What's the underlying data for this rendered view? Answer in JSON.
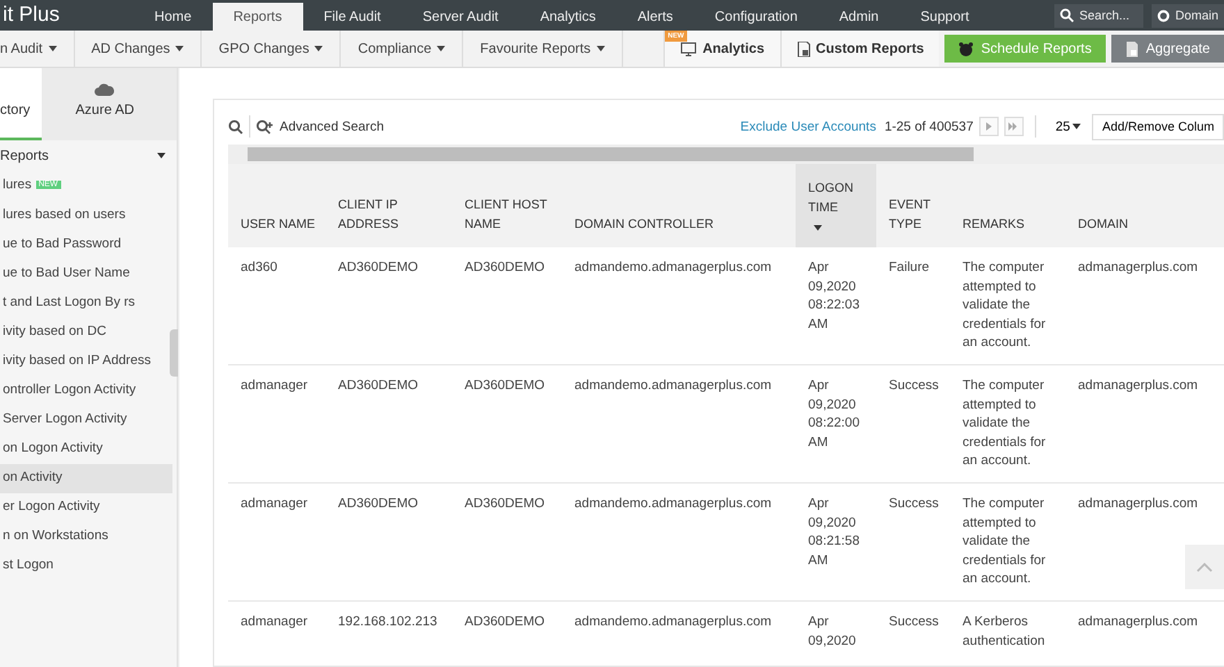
{
  "app": {
    "title": "it Plus"
  },
  "nav": [
    {
      "label": "Home",
      "selected": false
    },
    {
      "label": "Reports",
      "selected": true
    },
    {
      "label": "File Audit",
      "selected": false
    },
    {
      "label": "Server Audit",
      "selected": false
    },
    {
      "label": "Analytics",
      "selected": false
    },
    {
      "label": "Alerts",
      "selected": false
    },
    {
      "label": "Configuration",
      "selected": false
    },
    {
      "label": "Admin",
      "selected": false
    },
    {
      "label": "Support",
      "selected": false
    }
  ],
  "search": {
    "placeholder": "Search..."
  },
  "domain_button": "Domain",
  "subnav": [
    "n Audit",
    "AD Changes",
    "GPO Changes",
    "Compliance",
    "Favourite Reports"
  ],
  "actions": [
    {
      "kind": "tab",
      "label": "Analytics",
      "badge": "NEW"
    },
    {
      "kind": "tab",
      "label": "Custom Reports"
    },
    {
      "kind": "green",
      "label": "Schedule Reports"
    },
    {
      "kind": "grey",
      "label": "Aggregate"
    }
  ],
  "sidebar": {
    "tabs": [
      {
        "label": "ctory",
        "selected": true
      },
      {
        "label": "Azure AD",
        "selected": false
      }
    ],
    "section": "Reports",
    "items": [
      {
        "label": "lures",
        "badge": "NEW",
        "selected": false
      },
      {
        "label": "lures based on users",
        "selected": false
      },
      {
        "label": "ue to Bad Password",
        "selected": false
      },
      {
        "label": "ue to Bad User Name",
        "selected": false
      },
      {
        "label": "t and Last Logon By rs",
        "selected": false
      },
      {
        "label": "ivity based on DC",
        "selected": false
      },
      {
        "label": "ivity based on IP Address",
        "selected": false
      },
      {
        "label": "ontroller Logon Activity",
        "selected": false
      },
      {
        "label": "Server Logon Activity",
        "selected": false
      },
      {
        "label": "on Logon Activity",
        "selected": false
      },
      {
        "label": "on Activity",
        "selected": true
      },
      {
        "label": "er Logon Activity",
        "selected": false
      },
      {
        "label": "n on Workstations",
        "selected": false
      },
      {
        "label": "st Logon",
        "selected": false
      }
    ]
  },
  "toolbar": {
    "advanced_search": "Advanced Search",
    "exclude_link": "Exclude User Accounts",
    "range": "1-25 of 400537",
    "page_size": "25",
    "columns_button": "Add/Remove Colum"
  },
  "table": {
    "columns": [
      {
        "label": "USER NAME",
        "sorted": false
      },
      {
        "label": "CLIENT IP ADDRESS",
        "sorted": false
      },
      {
        "label": "CLIENT HOST NAME",
        "sorted": false
      },
      {
        "label": "DOMAIN CONTROLLER",
        "sorted": false
      },
      {
        "label": "LOGON TIME",
        "sorted": true
      },
      {
        "label": "EVENT TYPE",
        "sorted": false
      },
      {
        "label": "REMARKS",
        "sorted": false
      },
      {
        "label": "DOMAIN",
        "sorted": false
      }
    ],
    "rows": [
      [
        "ad360",
        "AD360DEMO",
        "AD360DEMO",
        "admandemo.admanagerplus.com",
        "Apr 09,2020 08:22:03 AM",
        "Failure",
        "The computer attempted to validate the credentials for an account.",
        "admanagerplus.com"
      ],
      [
        "admanager",
        "AD360DEMO",
        "AD360DEMO",
        "admandemo.admanagerplus.com",
        "Apr 09,2020 08:22:00 AM",
        "Success",
        "The computer attempted to validate the credentials for an account.",
        "admanagerplus.com"
      ],
      [
        "admanager",
        "AD360DEMO",
        "AD360DEMO",
        "admandemo.admanagerplus.com",
        "Apr 09,2020 08:21:58 AM",
        "Success",
        "The computer attempted to validate the credentials for an account.",
        "admanagerplus.com"
      ],
      [
        "admanager",
        "192.168.102.213",
        "AD360DEMO",
        "admandemo.admanagerplus.com",
        "Apr 09,2020",
        "Success",
        "A Kerberos authentication",
        "admanagerplus.com"
      ]
    ]
  }
}
